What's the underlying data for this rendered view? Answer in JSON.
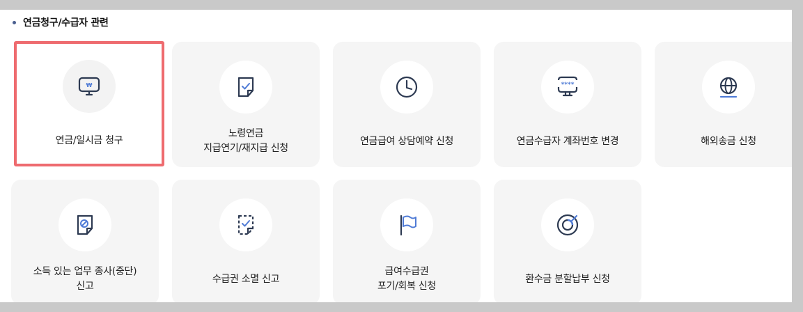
{
  "section": {
    "title": "연금청구/수급자 관련"
  },
  "colors": {
    "icon": "#2d3a52",
    "icon_accent": "#4f7bd6",
    "highlight": "#ee6b6f",
    "card_bg": "#f5f5f5"
  },
  "cards": [
    {
      "icon": "monitor-won-icon",
      "lines": [
        "연금/일시금 청구"
      ],
      "selected": true
    },
    {
      "icon": "document-check-icon",
      "lines": [
        "노령연금",
        "지급연기/재지급 신청"
      ]
    },
    {
      "icon": "clock-icon",
      "lines": [
        "연금급여 상담예약 신청"
      ]
    },
    {
      "icon": "monitor-password-icon",
      "lines": [
        "연금수급자 계좌번호 변경"
      ]
    },
    {
      "icon": "globe-icon",
      "lines": [
        "해외송금 신청"
      ]
    },
    {
      "icon": "document-prohibited-icon",
      "lines": [
        "소득 있는 업무 종사(중단)",
        "신고"
      ]
    },
    {
      "icon": "dashed-document-check-icon",
      "lines": [
        "수급권 소멸 신고"
      ]
    },
    {
      "icon": "flag-icon",
      "lines": [
        "급여수급권",
        "포기/회복 신청"
      ]
    },
    {
      "icon": "refund-circle-icon",
      "lines": [
        "환수금 분할납부 신청"
      ]
    }
  ]
}
